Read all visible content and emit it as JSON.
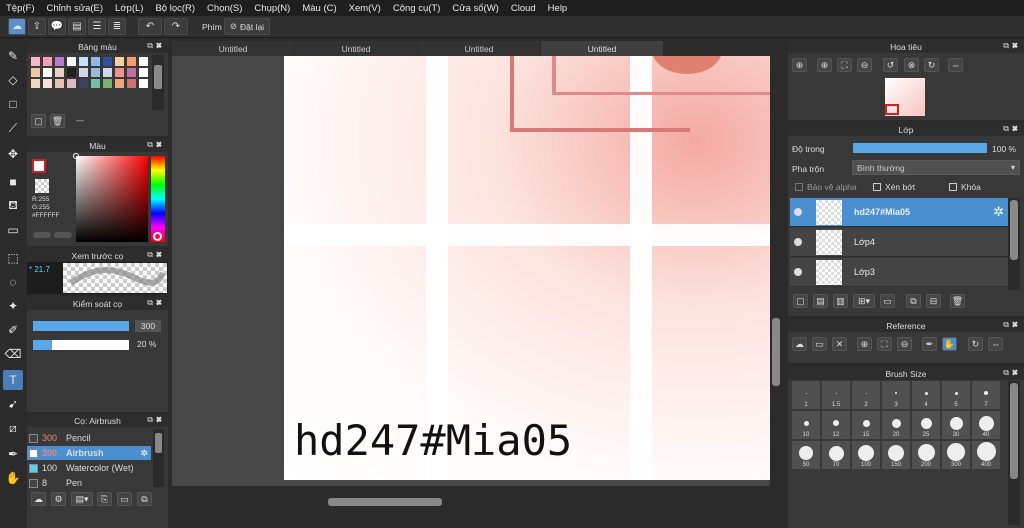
{
  "menu": [
    "Tệp(F)",
    "Chỉnh sửa(E)",
    "Lớp(L)",
    "Bộ lọc(R)",
    "Chọn(S)",
    "Chụp(N)",
    "Màu (C)",
    "Xem(V)",
    "Công cụ(T)",
    "Cửa sổ(W)",
    "Cloud",
    "Help"
  ],
  "toolbar": {
    "phim_label": "Phím",
    "reset_label": "Đặt lại"
  },
  "tabs": [
    "Untitled",
    "Untitled",
    "Untitled",
    "Untitled"
  ],
  "palette": {
    "title": "Bảng màu",
    "footer_text": "---",
    "swatches": [
      "#f6b8c9",
      "#f2a0b8",
      "#b97bd0",
      "#ffffff",
      "#c8e0f8",
      "#8fb8e8",
      "#3050a0",
      "#f8d0a8",
      "#f0a070",
      "#ffffff",
      "#f0c8a8",
      "#ffffff",
      "#e8d4c0",
      "#202020",
      "#d0d8e8",
      "#a0b8d8",
      "#d0d8f0",
      "#f09090",
      "#c070a0",
      "#ffffff",
      "#f0d8c0",
      "#f8e0d8",
      "#e8c0b8",
      "#e0b8c0",
      "#404060",
      "#70c0a0",
      "#80b070",
      "#e8a880",
      "#d07070",
      "#ffffff"
    ]
  },
  "color_panel": {
    "title": "Màu",
    "r": "R:255",
    "g": "G:255",
    "hex": "#FFFFFF"
  },
  "brush_preview": {
    "title": "Xem trước cọ",
    "size": "21.7"
  },
  "brush_control": {
    "title": "Kiểm soát cọ",
    "size_value": "300",
    "opacity_value": "20 %",
    "size_fill": 1.0,
    "opacity_fill": 0.2
  },
  "brush_list": {
    "title": "Cọ: Airbrush",
    "items": [
      {
        "size": "300",
        "name": "Pencil",
        "color": "#444"
      },
      {
        "size": "300",
        "name": "Airbrush",
        "color": "#fff"
      },
      {
        "size": "100",
        "name": "Watercolor (Wet)",
        "color": "#5ad0f0"
      },
      {
        "size": "8",
        "name": "Pen",
        "color": "#444"
      }
    ]
  },
  "canvas_text": "hd247#Mia05",
  "navigator": {
    "title": "Hoa tiêu"
  },
  "layer_panel": {
    "title": "Lớp",
    "opacity_label": "Độ trong",
    "opacity_value": "100 %",
    "opacity_fill": 1.0,
    "blend_label": "Pha trộn",
    "blend_value": "Bình thường",
    "protect_alpha": "Bảo vệ alpha",
    "clipping": "Xén bớt",
    "lock": "Khóa",
    "layers": [
      {
        "name": "hd247#Mia05",
        "selected": true
      },
      {
        "name": "Lớp4",
        "selected": false
      },
      {
        "name": "Lớp3",
        "selected": false
      }
    ]
  },
  "reference": {
    "title": "Reference"
  },
  "brush_size": {
    "title": "Brush Size",
    "sizes": [
      "1",
      "1.5",
      "2",
      "3",
      "4",
      "5",
      "7",
      "10",
      "12",
      "15",
      "20",
      "25",
      "30",
      "40",
      "50",
      "70",
      "100",
      "150",
      "200",
      "300",
      "400"
    ],
    "dots": [
      1,
      1,
      1,
      2,
      3,
      3,
      4,
      5,
      6,
      7,
      9,
      11,
      13,
      15,
      14,
      15,
      16,
      16,
      17,
      18,
      19
    ]
  },
  "colors": {
    "accent": "#4a8fd0",
    "canvas_bg": "#474747"
  }
}
